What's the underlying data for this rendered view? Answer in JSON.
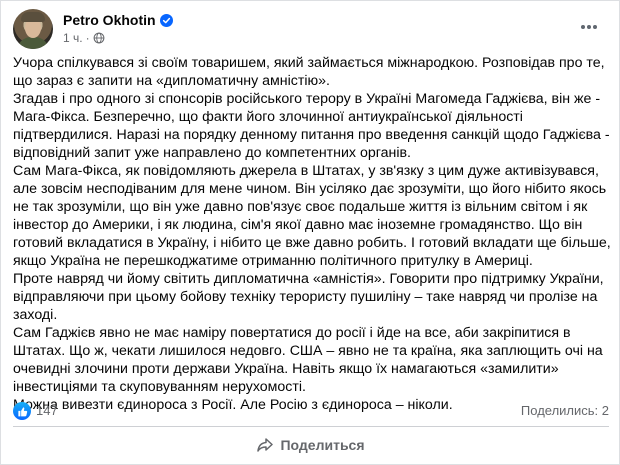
{
  "post": {
    "author": "Petro Okhotin",
    "time": "1 ч.",
    "paragraphs": [
      "Учора спілкувався зі своїм товаришем, який займається міжнародкою. Розповідав про те, що зараз є запити на «дипломатичну амністію».",
      "Згадав і про одного зі спонсорів російського терору в Україні Магомеда Гаджієва, він же - Мага-Фікса. Безперечно, що факти його злочинної антиукраїнської діяльності підтвердилися. Наразі на порядку денному питання про введення санкцій щодо Гаджієва - відповідний запит уже направлено до компетентних органів.",
      "Сам Мага-Фікса, як повідомляють джерела в Штатах, у зв'язку з цим дуже активізувався, але зовсім несподіваним для мене чином. Він усіляко дає зрозуміти, що його нібито якось не так зрозуміли, що він уже давно пов'язує своє подальше життя із вільним світом і як інвестор до Америки, і як людина, сім'я якої давно має іноземне громадянство. Що він готовий вкладатися в Україну, і нібито це вже давно робить. І готовий вкладати ще більше, якщо Україна не перешкоджатиме отриманню політичного притулку в Америці.",
      "Проте навряд чи йому світить дипломатична «амністія». Говорити про підтримку України, відправляючи при цьому бойову техніку терористу пушиліну – таке навряд чи пролізе на заході.",
      "Сам Гаджієв явно не має наміру повертатися до росії і йде на все, аби закріпитися в Штатах. Що ж, чекати лишилося недовго. США – явно не та країна, яка заплющить очі на очевидні злочини проти держави Україна. Навіть якщо їх намагаються «замилити» інвестиціями та скуповуванням нерухомості.",
      "Можна вивезти єдинороса з Росії. Але Росію з єдинороса – ніколи."
    ]
  },
  "stats": {
    "likes": "147",
    "shares": "Поделились: 2"
  },
  "actions": {
    "share_label": "Поделиться"
  },
  "colors": {
    "accent": "#0866ff",
    "text": "#050505",
    "muted": "#65676b"
  },
  "icons": [
    "verified-badge-icon",
    "globe-icon",
    "more-options-icon",
    "like-icon",
    "share-icon"
  ]
}
